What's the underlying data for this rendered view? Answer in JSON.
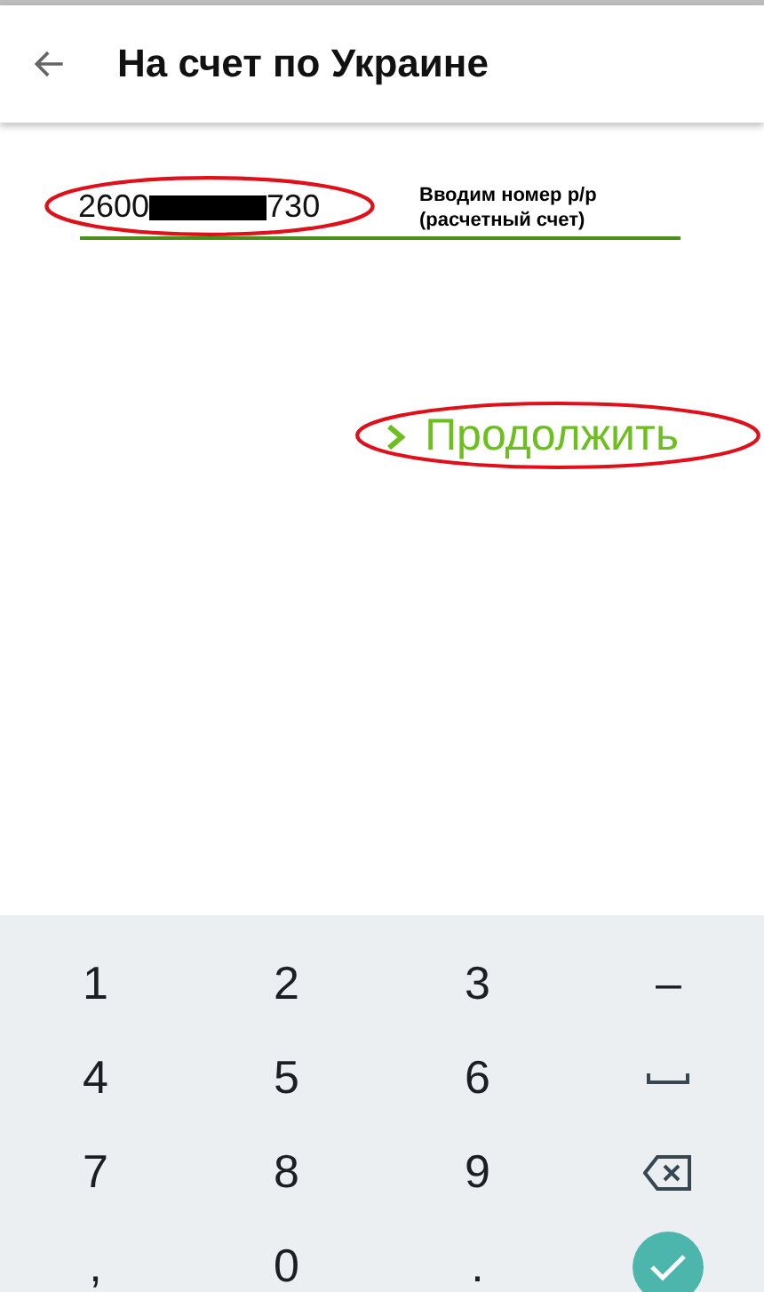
{
  "app_bar": {
    "title": "На счет по Украине"
  },
  "account_field": {
    "value_start": "2600",
    "value_end": "730",
    "redacted": true,
    "highlighted": true
  },
  "annotation": {
    "lines": [
      "Вводим номер р/р",
      "(расчетный счет)"
    ]
  },
  "continue_button": {
    "label": "Продолжить",
    "highlighted": true
  },
  "keypad": {
    "keys": [
      {
        "kind": "char",
        "label": "1"
      },
      {
        "kind": "char",
        "label": "2"
      },
      {
        "kind": "char",
        "label": "3"
      },
      {
        "kind": "char",
        "label": "–"
      },
      {
        "kind": "char",
        "label": "4"
      },
      {
        "kind": "char",
        "label": "5"
      },
      {
        "kind": "char",
        "label": "6"
      },
      {
        "kind": "space"
      },
      {
        "kind": "char",
        "label": "7"
      },
      {
        "kind": "char",
        "label": "8"
      },
      {
        "kind": "char",
        "label": "9"
      },
      {
        "kind": "backspace"
      },
      {
        "kind": "char",
        "label": ","
      },
      {
        "kind": "char",
        "label": "0"
      },
      {
        "kind": "char",
        "label": "."
      },
      {
        "kind": "done"
      }
    ]
  }
}
